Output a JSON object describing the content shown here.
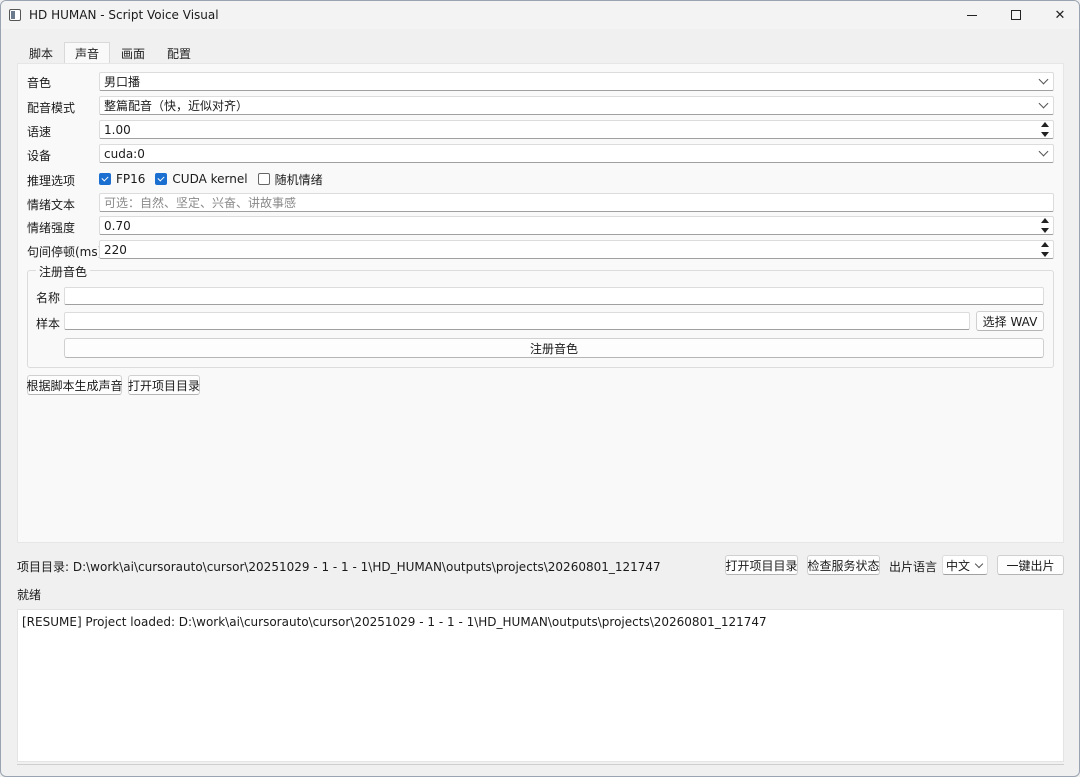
{
  "window": {
    "title": "HD HUMAN - Script Voice Visual",
    "minimize_label": "",
    "maximize_label": "",
    "close_label": "✕"
  },
  "tabs": [
    {
      "label": "脚本",
      "active": false
    },
    {
      "label": "声音",
      "active": true
    },
    {
      "label": "画面",
      "active": false
    },
    {
      "label": "配置",
      "active": false
    }
  ],
  "form": {
    "voice": {
      "label": "音色",
      "value": "男口播"
    },
    "dub_mode": {
      "label": "配音模式",
      "value": "整篇配音（快，近似对齐）"
    },
    "speed": {
      "label": "语速",
      "value": "1.00"
    },
    "device": {
      "label": "设备",
      "value": "cuda:0"
    },
    "inference": {
      "label": "推理选项",
      "fp16": {
        "label": "FP16",
        "checked": true
      },
      "cuda_kernel": {
        "label": "CUDA kernel",
        "checked": true
      },
      "random_emotion": {
        "label": "随机情绪",
        "checked": false
      }
    },
    "emotion_text": {
      "label": "情绪文本",
      "value": "",
      "placeholder": "可选：自然、坚定、兴奋、讲故事感"
    },
    "emotion_strength": {
      "label": "情绪强度",
      "value": "0.70"
    },
    "pause": {
      "label": "句间停顿(ms)",
      "value": "220"
    }
  },
  "register": {
    "group_title": "注册音色",
    "name_label": "名称",
    "name_value": "",
    "sample_label": "样本",
    "sample_value": "",
    "choose_wav": "选择 WAV",
    "register_button": "注册音色"
  },
  "actions": {
    "generate": "根据脚本生成声音",
    "open_dir": "打开项目目录"
  },
  "footer": {
    "project_dir": "项目目录: D:\\work\\ai\\cursorauto\\cursor\\20251029 - 1 - 1 - 1\\HD_HUMAN\\outputs\\projects\\20260801_121747",
    "open_dir": "打开项目目录",
    "check_status": "检查服务状态",
    "lang_label": "出片语言",
    "lang_value": "中文",
    "one_click": "一键出片",
    "status": "就绪"
  },
  "log": {
    "lines": [
      "[RESUME] Project loaded: D:\\work\\ai\\cursorauto\\cursor\\20251029 - 1 - 1 - 1\\HD_HUMAN\\outputs\\projects\\20260801_121747"
    ]
  }
}
